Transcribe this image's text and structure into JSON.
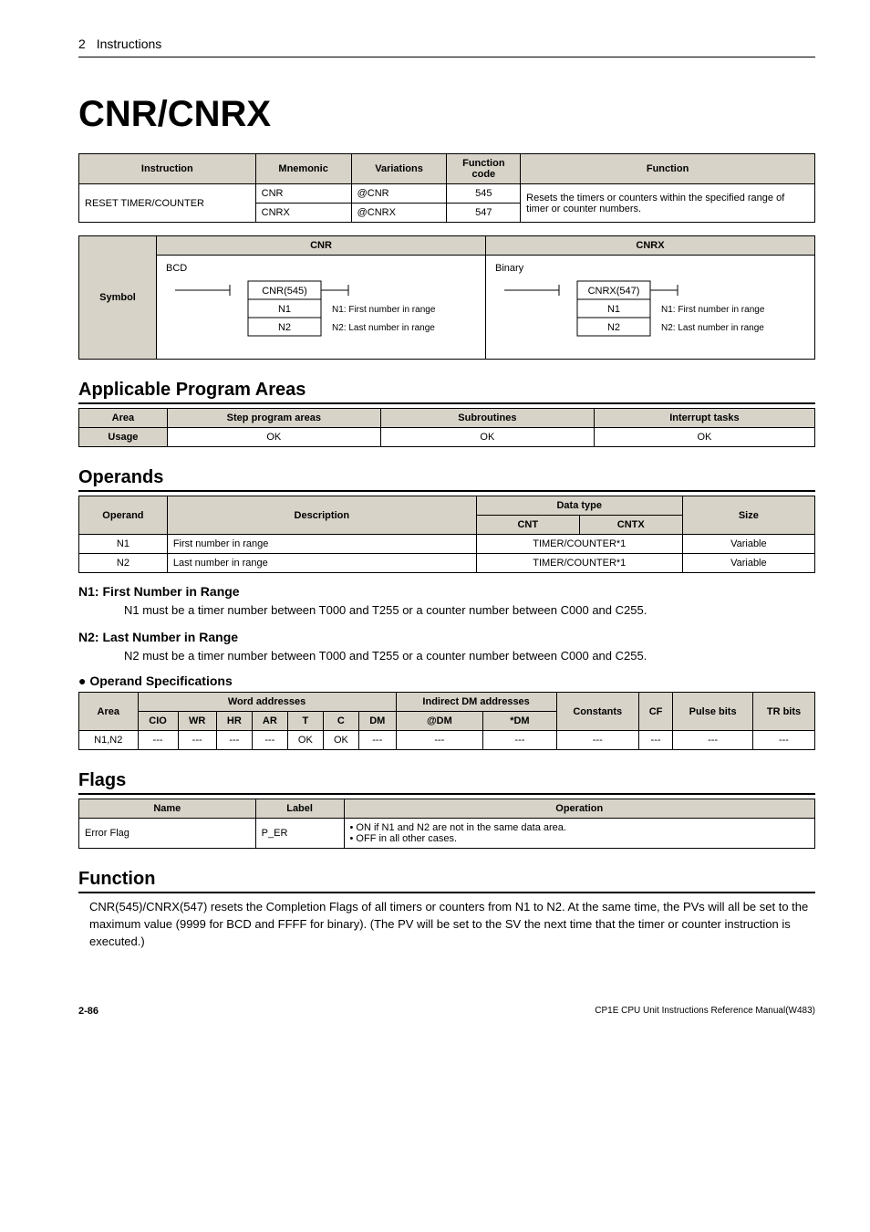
{
  "header": {
    "chapter": "2",
    "title": "Instructions"
  },
  "main_title": "CNR/CNRX",
  "instr_table": {
    "headers": [
      "Instruction",
      "Mnemonic",
      "Variations",
      "Function code",
      "Function"
    ],
    "instr_name": "RESET TIMER/COUNTER",
    "rows": [
      {
        "mn": "CNR",
        "var": "@CNR",
        "code": "545"
      },
      {
        "mn": "CNRX",
        "var": "@CNRX",
        "code": "547"
      }
    ],
    "func": "Resets the timers or counters within the specified range of timer or counter numbers."
  },
  "symbol": {
    "row_label": "Symbol",
    "cnr_header": "CNR",
    "cnrx_header": "CNRX",
    "cnr": {
      "label": "BCD",
      "box": "CNR(545)",
      "n1": "N1",
      "n2": "N2",
      "n1d": "N1: First number in range",
      "n2d": "N2: Last number in range"
    },
    "cnrx": {
      "label": "Binary",
      "box": "CNRX(547)",
      "n1": "N1",
      "n2": "N2",
      "n1d": "N1: First number in range",
      "n2d": "N2: Last number in range"
    }
  },
  "areas": {
    "title": "Applicable Program Areas",
    "headers": [
      "Area",
      "Step program areas",
      "Subroutines",
      "Interrupt tasks"
    ],
    "row_label": "Usage",
    "values": [
      "OK",
      "OK",
      "OK"
    ]
  },
  "operands": {
    "title": "Operands",
    "headers": {
      "operand": "Operand",
      "desc": "Description",
      "dtype": "Data type",
      "cnt": "CNT",
      "cntx": "CNTX",
      "size": "Size"
    },
    "rows": [
      {
        "op": "N1",
        "desc": "First number in range",
        "dtype": "TIMER/COUNTER*1",
        "size": "Variable"
      },
      {
        "op": "N2",
        "desc": "Last number in range",
        "dtype": "TIMER/COUNTER*1",
        "size": "Variable"
      }
    ]
  },
  "n1_section": {
    "title": "N1: First Number in Range",
    "text": "N1 must be a timer number between T000 and T255 or a counter number between C000 and C255."
  },
  "n2_section": {
    "title": "N2: Last Number in Range",
    "text": "N2 must be a timer number between T000 and T255 or a counter number between C000 and C255."
  },
  "opspec": {
    "title": "Operand Specifications",
    "headers": {
      "area": "Area",
      "word": "Word addresses",
      "indirect": "Indirect DM addresses",
      "constants": "Constants",
      "cf": "CF",
      "pulse": "Pulse bits",
      "tr": "TR bits",
      "cio": "CIO",
      "wr": "WR",
      "hr": "HR",
      "ar": "AR",
      "t": "T",
      "c": "C",
      "dm": "DM",
      "atdm": "@DM",
      "stardm": "*DM"
    },
    "row": {
      "area": "N1,N2",
      "cio": "---",
      "wr": "---",
      "hr": "---",
      "ar": "---",
      "t": "OK",
      "c": "OK",
      "dm": "---",
      "atdm": "---",
      "stardm": "---",
      "const": "---",
      "cf": "---",
      "pulse": "---",
      "tr": "---"
    }
  },
  "flags": {
    "title": "Flags",
    "headers": [
      "Name",
      "Label",
      "Operation"
    ],
    "row": {
      "name": "Error Flag",
      "label": "P_ER",
      "op1": "ON if N1 and N2 are not in the same data area.",
      "op2": "OFF in all other cases."
    }
  },
  "function": {
    "title": "Function",
    "text": "CNR(545)/CNRX(547) resets the Completion Flags of all timers or counters from N1 to N2. At the same time, the PVs will all be set to the maximum value (9999 for BCD and FFFF for binary). (The PV will be set to the SV the next time that the timer or counter instruction is executed.)"
  },
  "footer": {
    "page": "2-86",
    "manual": "CP1E CPU Unit Instructions Reference Manual(W483)"
  }
}
